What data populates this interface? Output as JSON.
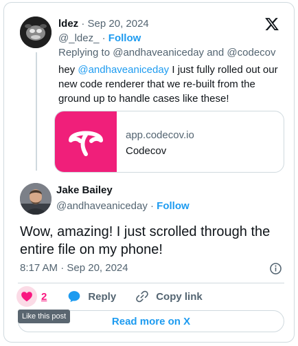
{
  "reply_tweet": {
    "author_name": "ldez",
    "separator": " · ",
    "date": "Sep 20, 2024",
    "handle": "@_ldez_",
    "follow_label": "Follow",
    "replying_prefix": "Replying to ",
    "replying_to_1": "@andhaveaniceday",
    "replying_and": " and ",
    "replying_to_2": "@codecov",
    "text_prefix": "hey ",
    "text_mention": "@andhaveaniceday",
    "text_body": " I just fully rolled out our new code renderer that we re-built from the ground up to handle cases like these!",
    "link_card": {
      "domain": "app.codecov.io",
      "title": "Codecov"
    }
  },
  "main_tweet": {
    "author_name": "Jake Bailey",
    "handle": "@andhaveaniceday",
    "separator": " · ",
    "follow_label": "Follow",
    "text": "Wow, amazing! I just scrolled through the entire file on my phone!",
    "timestamp": "8:17 AM · Sep 20, 2024"
  },
  "actions": {
    "like_count": "2",
    "reply_label": "Reply",
    "copy_label": "Copy link",
    "like_tooltip": "Like this post"
  },
  "read_more_label": "Read more on X",
  "colors": {
    "accent": "#1d9bf0",
    "like": "#f91880",
    "codecov_brand": "#f01f7a",
    "muted": "#536471",
    "border": "#cfd9de"
  }
}
